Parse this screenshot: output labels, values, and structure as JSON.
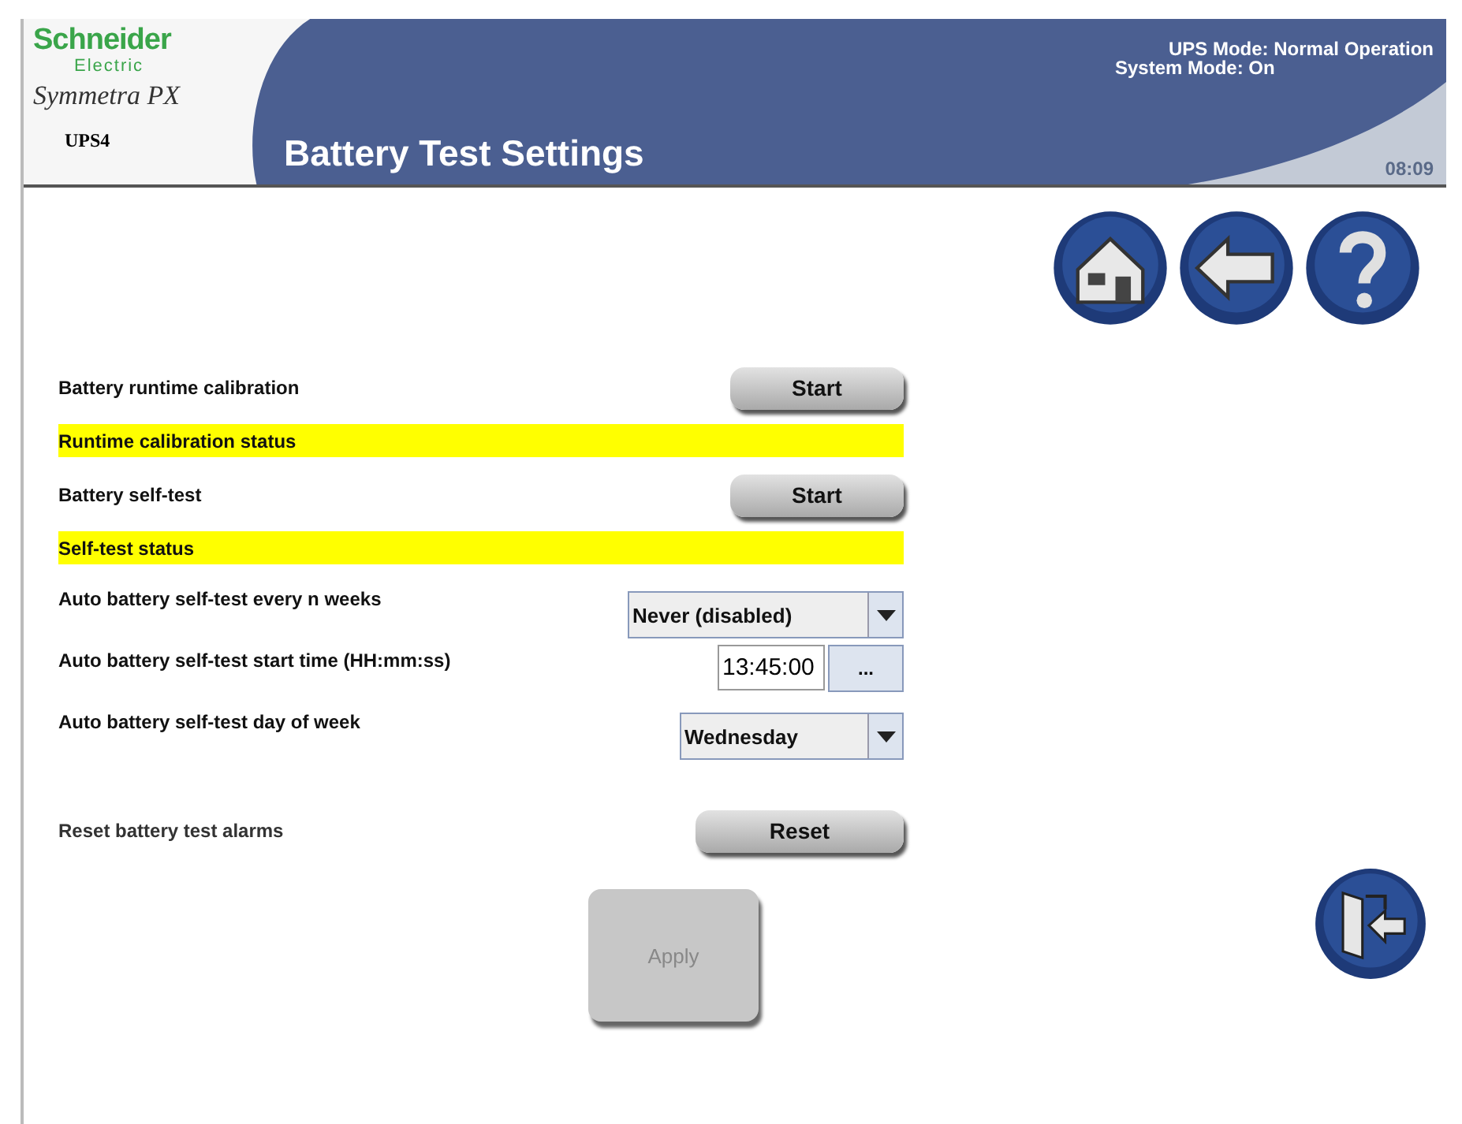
{
  "header": {
    "brand": "Schneider",
    "brand_sub": "Electric",
    "product": "Symmetra PX",
    "unit": "UPS4",
    "title": "Battery Test Settings",
    "ups_mode": "UPS Mode: Normal Operation",
    "system_mode": "System Mode: On",
    "time": "08:09"
  },
  "nav_buttons": [
    {
      "kind": "home"
    },
    {
      "kind": "back"
    },
    {
      "kind": "help"
    }
  ],
  "rows": [
    {
      "kind": "button",
      "label": "Battery runtime calibration",
      "button": "Start"
    },
    {
      "kind": "status",
      "label": "Runtime calibration status"
    },
    {
      "kind": "button",
      "label": "Battery self-test",
      "button": "Start"
    },
    {
      "kind": "status",
      "label": "Self-test status"
    },
    {
      "kind": "dropdown",
      "label": "Auto battery self-test every n weeks",
      "value": "Never (disabled)"
    },
    {
      "kind": "time",
      "label": "Auto battery self-test start time (HH:mm:ss)",
      "value": "13:45:00",
      "button": "..."
    },
    {
      "kind": "dropdown",
      "label": "Auto battery self-test day of week",
      "value": "Wednesday"
    },
    {
      "kind": "reset",
      "label": "Reset battery test alarms",
      "button": "Reset"
    }
  ],
  "apply": {
    "label": "Apply",
    "disabled": true
  }
}
